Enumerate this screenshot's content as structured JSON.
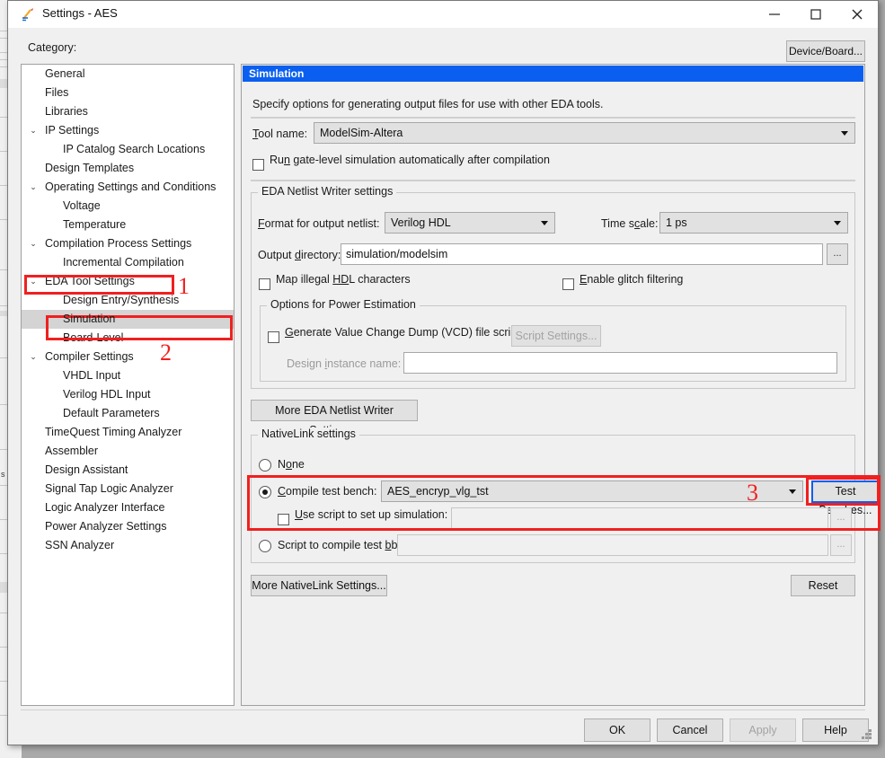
{
  "window": {
    "title": "Settings - AES",
    "icon": "quartus-pencil-icon",
    "minimize": "—",
    "maximize": "□",
    "close": "✕"
  },
  "header": {
    "category_label": "Category:",
    "device_board_button": "Device/Board..."
  },
  "accent": {
    "panel_header_bg": "#0b5ff0",
    "annotation_red": "#f02020",
    "selection_gray": "#d4d4d4"
  },
  "tree": {
    "items": [
      {
        "label": "General",
        "level": 0,
        "chevron": "",
        "selected": false
      },
      {
        "label": "Files",
        "level": 0,
        "chevron": "",
        "selected": false
      },
      {
        "label": "Libraries",
        "level": 0,
        "chevron": "",
        "selected": false
      },
      {
        "label": "IP Settings",
        "level": 0,
        "chevron": "⌄",
        "selected": false
      },
      {
        "label": "IP Catalog Search Locations",
        "level": 1,
        "chevron": "",
        "selected": false
      },
      {
        "label": "Design Templates",
        "level": 0,
        "chevron": "",
        "selected": false
      },
      {
        "label": "Operating Settings and Conditions",
        "level": 0,
        "chevron": "⌄",
        "selected": false
      },
      {
        "label": "Voltage",
        "level": 1,
        "chevron": "",
        "selected": false
      },
      {
        "label": "Temperature",
        "level": 1,
        "chevron": "",
        "selected": false
      },
      {
        "label": "Compilation Process Settings",
        "level": 0,
        "chevron": "⌄",
        "selected": false
      },
      {
        "label": "Incremental Compilation",
        "level": 1,
        "chevron": "",
        "selected": false
      },
      {
        "label": "EDA Tool Settings",
        "level": 0,
        "chevron": "⌄",
        "selected": false
      },
      {
        "label": "Design Entry/Synthesis",
        "level": 1,
        "chevron": "",
        "selected": false
      },
      {
        "label": "Simulation",
        "level": 1,
        "chevron": "",
        "selected": true
      },
      {
        "label": "Board-Level",
        "level": 1,
        "chevron": "",
        "selected": false
      },
      {
        "label": "Compiler Settings",
        "level": 0,
        "chevron": "⌄",
        "selected": false
      },
      {
        "label": "VHDL Input",
        "level": 1,
        "chevron": "",
        "selected": false
      },
      {
        "label": "Verilog HDL Input",
        "level": 1,
        "chevron": "",
        "selected": false
      },
      {
        "label": "Default Parameters",
        "level": 1,
        "chevron": "",
        "selected": false
      },
      {
        "label": "TimeQuest Timing Analyzer",
        "level": 0,
        "chevron": "",
        "selected": false
      },
      {
        "label": "Assembler",
        "level": 0,
        "chevron": "",
        "selected": false
      },
      {
        "label": "Design Assistant",
        "level": 0,
        "chevron": "",
        "selected": false
      },
      {
        "label": "Signal Tap Logic Analyzer",
        "level": 0,
        "chevron": "",
        "selected": false
      },
      {
        "label": "Logic Analyzer Interface",
        "level": 0,
        "chevron": "",
        "selected": false
      },
      {
        "label": "Power Analyzer Settings",
        "level": 0,
        "chevron": "",
        "selected": false
      },
      {
        "label": "SSN Analyzer",
        "level": 0,
        "chevron": "",
        "selected": false
      }
    ]
  },
  "panel": {
    "title": "Simulation",
    "description": "Specify options for generating output files for use with other EDA tools.",
    "tool_name_label": "Tool name:",
    "tool_name_value": "ModelSim-Altera",
    "run_gatelevel_label": "Run gate-level simulation automatically after compilation",
    "run_gatelevel_checked": false,
    "netlist_group": {
      "title": "EDA Netlist Writer settings",
      "format_label": "Format for output netlist:",
      "format_value": "Verilog HDL",
      "timescale_label": "Time scale:",
      "timescale_value": "1 ps",
      "outdir_label": "Output directory:",
      "outdir_value": "simulation/modelsim",
      "browse_label": "...",
      "map_illegal_label": "Map illegal HDL characters",
      "map_illegal_checked": false,
      "glitch_label": "Enable glitch filtering",
      "glitch_checked": false,
      "power_group": {
        "title": "Options for Power Estimation",
        "vcd_label": "Generate Value Change Dump (VCD) file script",
        "vcd_checked": false,
        "script_settings_button": "Script Settings...",
        "design_instance_label": "Design instance name:",
        "design_instance_value": ""
      }
    },
    "more_eda_button": "More EDA Netlist Writer Settings...",
    "nativelink_group": {
      "title": "NativeLink settings",
      "none_label": "None",
      "none_selected": false,
      "compile_tb_label": "Compile test bench:",
      "compile_tb_selected": true,
      "compile_tb_value": "AES_encryp_vlg_tst",
      "test_benches_button": "Test Benches...",
      "use_script_label": "Use script to set up simulation:",
      "use_script_checked": false,
      "use_script_value": "",
      "script_compile_label": "Script to compile test bench:",
      "script_compile_selected": false,
      "script_compile_value": "",
      "browse_label": "..."
    },
    "more_nativelink_button": "More NativeLink Settings...",
    "reset_button": "Reset"
  },
  "annotations": [
    {
      "number": "1",
      "target": "eda-tool-settings-tree-item"
    },
    {
      "number": "2",
      "target": "simulation-tree-item"
    },
    {
      "number": "3",
      "target": "test-benches-button"
    }
  ],
  "footer": {
    "ok": "OK",
    "cancel": "Cancel",
    "apply": "Apply",
    "apply_enabled": false,
    "help": "Help"
  }
}
